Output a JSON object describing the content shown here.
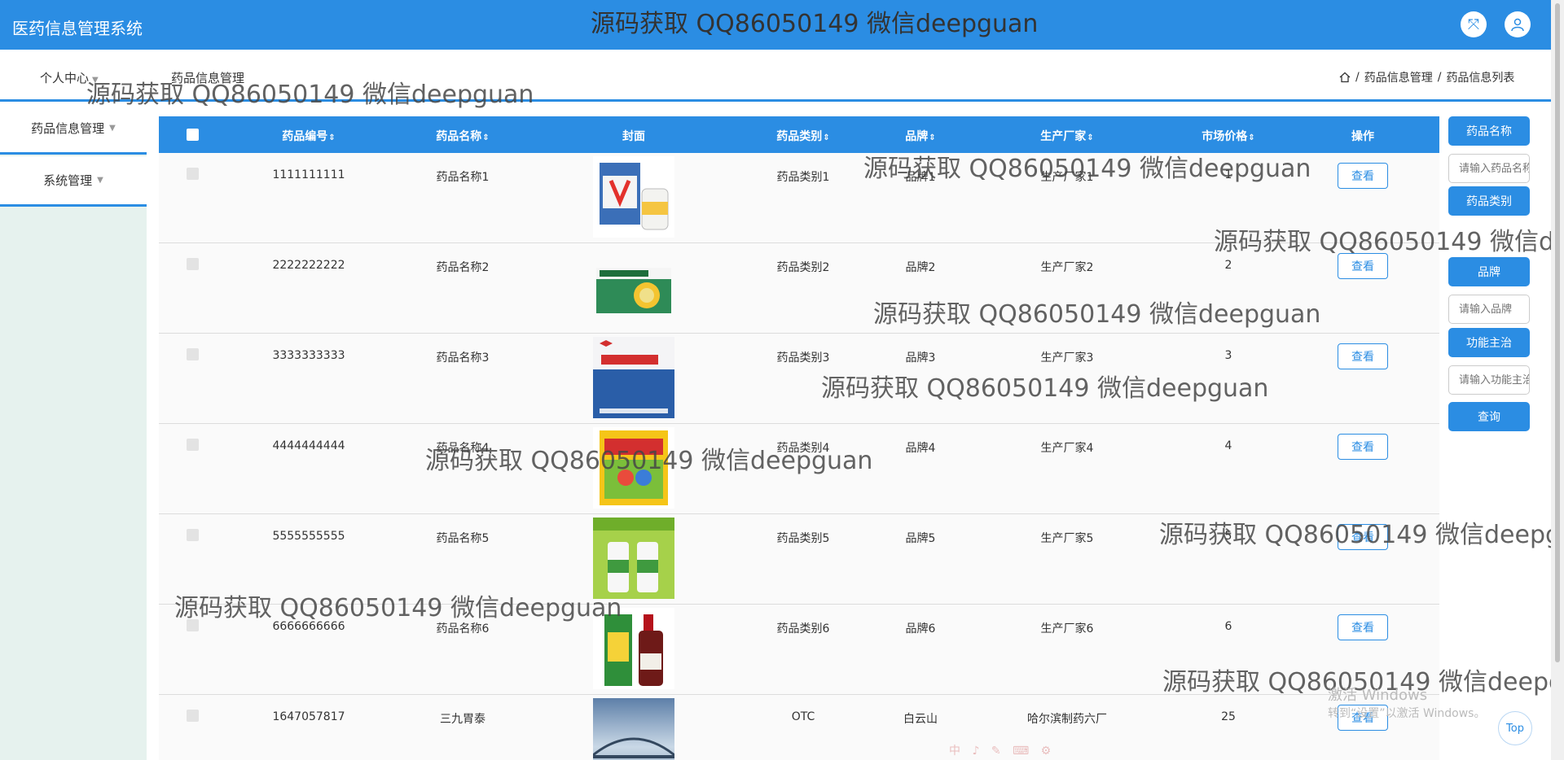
{
  "header": {
    "app_title": "医药信息管理系统",
    "watermark": "源码获取 QQ86050149 微信deepguan",
    "fullscreen_icon": "fullscreen-icon",
    "user_icon": "user-icon"
  },
  "topnav": {
    "items": [
      "个人中心",
      "药品信息管理"
    ],
    "breadcrumb": {
      "home_icon": "home-icon",
      "items": [
        "药品信息管理",
        "药品信息列表"
      ],
      "separator": "/"
    }
  },
  "sidebar": {
    "items": [
      "药品信息管理",
      "系统管理"
    ]
  },
  "table": {
    "columns": [
      "药品编号",
      "药品名称",
      "封面",
      "药品类别",
      "品牌",
      "生产厂家",
      "市场价格",
      "操作"
    ],
    "sort_icon": "sort-icon",
    "view_label": "查看",
    "rows": [
      {
        "code": "1111111111",
        "name": "药品名称1",
        "category": "药品类别1",
        "brand": "品牌1",
        "maker": "生产厂家1",
        "price": "1"
      },
      {
        "code": "2222222222",
        "name": "药品名称2",
        "category": "药品类别2",
        "brand": "品牌2",
        "maker": "生产厂家2",
        "price": "2"
      },
      {
        "code": "3333333333",
        "name": "药品名称3",
        "category": "药品类别3",
        "brand": "品牌3",
        "maker": "生产厂家3",
        "price": "3"
      },
      {
        "code": "4444444444",
        "name": "药品名称4",
        "category": "药品类别4",
        "brand": "品牌4",
        "maker": "生产厂家4",
        "price": "4"
      },
      {
        "code": "5555555555",
        "name": "药品名称5",
        "category": "药品类别5",
        "brand": "品牌5",
        "maker": "生产厂家5",
        "price": "5"
      },
      {
        "code": "6666666666",
        "name": "药品名称6",
        "category": "药品类别6",
        "brand": "品牌6",
        "maker": "生产厂家6",
        "price": "6"
      },
      {
        "code": "1647057817",
        "name": "三九胃泰",
        "category": "OTC",
        "brand": "白云山",
        "maker": "哈尔滨制药六厂",
        "price": "25"
      }
    ]
  },
  "search": {
    "name_label": "药品名称",
    "name_placeholder": "请输入药品名称",
    "category_label": "药品类别",
    "brand_label": "品牌",
    "brand_placeholder": "请输入品牌",
    "function_label": "功能主治",
    "function_placeholder": "请输入功能主治",
    "query_label": "查询"
  },
  "overlay": {
    "activation_title": "激活 Windows",
    "activation_sub": "转到“设置”以激活 Windows。",
    "top_label": "Top",
    "ime_text": "中 ♪ ✎ ⌨ ⚙"
  },
  "colors": {
    "primary": "#2b8de3",
    "sidebar_bg": "#e6f2ee",
    "row_bg": "#fafafa"
  }
}
